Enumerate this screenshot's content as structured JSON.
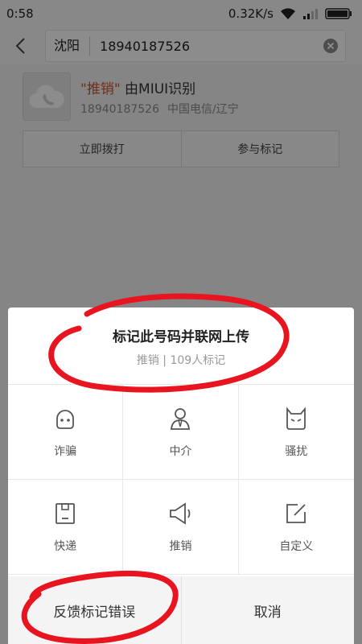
{
  "status_bar": {
    "time": "0:58",
    "network_speed": "0.32K/s"
  },
  "search": {
    "city": "沈阳",
    "query": "18940187526"
  },
  "result": {
    "tag_label": "\"推销\"",
    "tag_suffix": " 由MIUI识别",
    "number": "18940187526",
    "carrier": "中国电信/辽宁"
  },
  "actions": {
    "call": "立即拨打",
    "mark": "参与标记"
  },
  "sheet": {
    "title": "标记此号码并联网上传",
    "subtitle": "推销 | 109人标记",
    "options": [
      {
        "label": "诈骗",
        "icon": "fraud-face-icon"
      },
      {
        "label": "中介",
        "icon": "agent-person-icon"
      },
      {
        "label": "骚扰",
        "icon": "harass-devil-icon"
      },
      {
        "label": "快递",
        "icon": "delivery-box-icon"
      },
      {
        "label": "推销",
        "icon": "megaphone-icon"
      },
      {
        "label": "自定义",
        "icon": "edit-icon"
      }
    ],
    "feedback": "反馈标记错误",
    "cancel": "取消"
  },
  "colors": {
    "tag_red": "#d2522d",
    "annotation_red": "#e8141f"
  }
}
